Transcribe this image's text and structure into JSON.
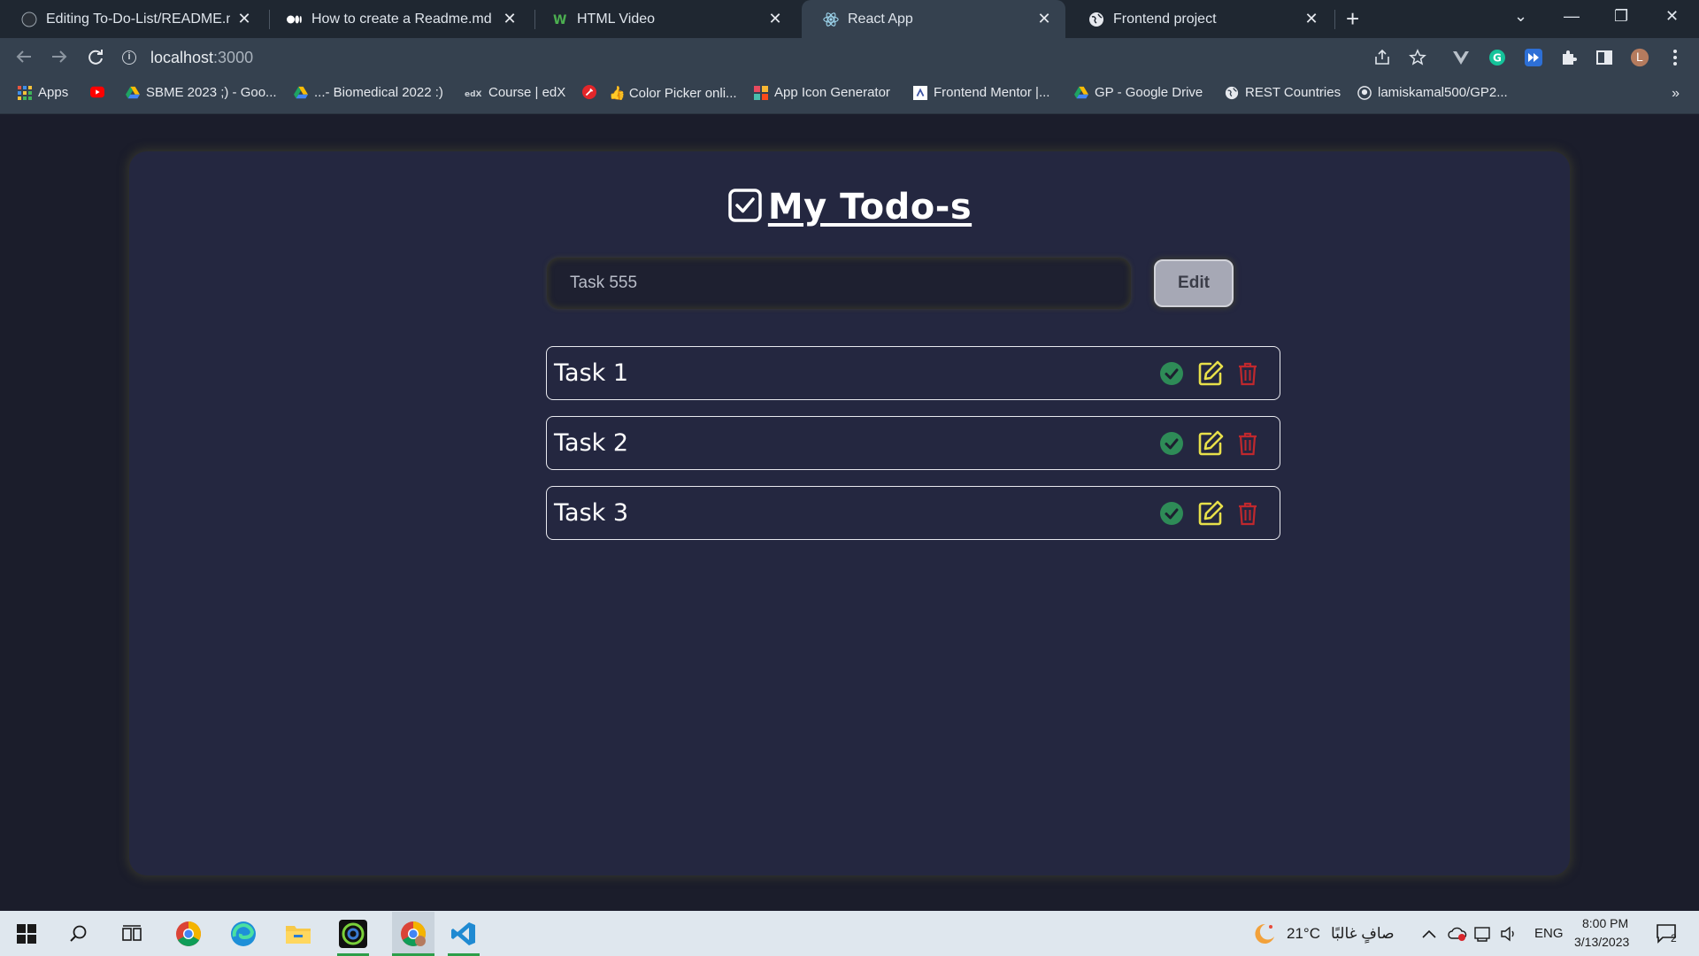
{
  "browser": {
    "tabs": [
      {
        "title": "Editing To-Do-List/README.md a",
        "icon": "github-icon",
        "active": false
      },
      {
        "title": "How to create a Readme.md file?",
        "icon": "medium-icon",
        "active": false
      },
      {
        "title": "HTML Video",
        "icon": "w3schools-icon",
        "active": false
      },
      {
        "title": "React App",
        "icon": "react-icon",
        "active": true
      },
      {
        "title": "Frontend project",
        "icon": "globe-icon",
        "active": false
      }
    ],
    "tab_close": "✕",
    "new_tab": "+",
    "window_controls": {
      "tab_search": "⌄",
      "minimize": "—",
      "restore": "❐",
      "close": "✕"
    },
    "url_host": "localhost",
    "url_port": ":3000",
    "profile_initial": "L",
    "bookmarks": [
      {
        "label": "Apps",
        "icon": "apps-grid-icon"
      },
      {
        "label": "",
        "icon": "youtube-icon"
      },
      {
        "label": "SBME 2023 ;) - Goo...",
        "icon": "google-drive-icon"
      },
      {
        "label": "...- Biomedical 2022 :)",
        "icon": "google-drive-icon"
      },
      {
        "label": "Course | edX",
        "icon": "edx-icon"
      },
      {
        "label": "",
        "icon": "color-picker-icon"
      },
      {
        "label": "👍 Color Picker onli...",
        "icon": ""
      },
      {
        "label": "App Icon Generator",
        "icon": "app-icon-generator-icon"
      },
      {
        "label": "Frontend Mentor |...",
        "icon": "frontend-mentor-icon"
      },
      {
        "label": "GP - Google Drive",
        "icon": "google-drive-icon"
      },
      {
        "label": "REST Countries",
        "icon": "globe-icon"
      },
      {
        "label": "lamiskamal500/GP2...",
        "icon": "github-icon"
      }
    ],
    "bookmarks_more": "»"
  },
  "app": {
    "title": "My Todo-s",
    "input": {
      "value": "Task 555",
      "placeholder": ""
    },
    "submit_label": "Edit",
    "todos": [
      {
        "text": "Task 1"
      },
      {
        "text": "Task 2"
      },
      {
        "text": "Task 3"
      }
    ],
    "colors": {
      "complete": "#2e8b57",
      "edit": "#e8e04a",
      "delete": "#c0282d"
    }
  },
  "taskbar": {
    "weather": "21°C",
    "weather_desc": "صافٍ غالبًا",
    "language": "ENG",
    "time": "8:00 PM",
    "date": "3/13/2023",
    "notifications": "2"
  }
}
